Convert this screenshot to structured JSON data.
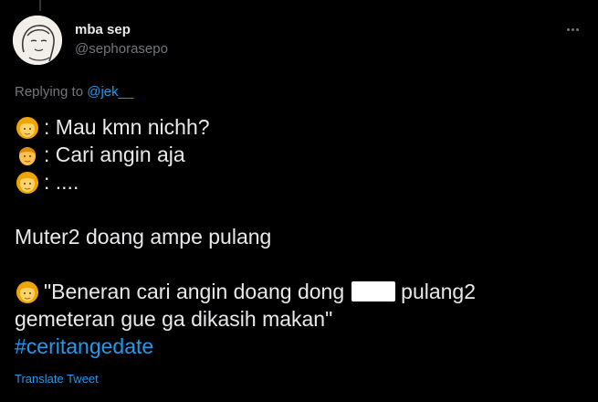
{
  "tweet": {
    "author": {
      "display_name": "mba sep",
      "handle": "@sephorasepo"
    },
    "replying_prefix": "Replying to",
    "replying_to": "@jek__",
    "lines": {
      "line1": ": Mau kmn nichh?",
      "line2": ": Cari angin aja",
      "line3": ": ....",
      "line4": "Muter2 doang ampe pulang",
      "line5_start": "\"Beneran cari angin doang dong",
      "line5_end": "pulang2",
      "line6": "gemeteran gue ga dikasih makan\"",
      "hashtag": "#ceritangedate"
    },
    "translate_label": "Translate Tweet",
    "emojis": [
      "woman-emoji",
      "man-emoji",
      "woman-emoji",
      "woman-emoji"
    ]
  },
  "colors": {
    "background": "#000000",
    "text": "#e7e9ea",
    "secondary": "#71767b",
    "accent": "#1d9bf0"
  }
}
